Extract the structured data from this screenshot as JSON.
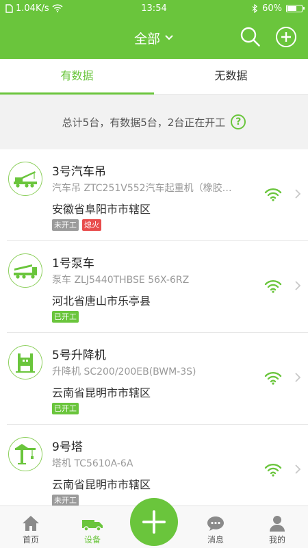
{
  "status_bar": {
    "speed": "1.04K/s",
    "time": "13:54",
    "battery": "60%",
    "battery_level": 0.6
  },
  "header": {
    "title": "全部"
  },
  "tabs": [
    {
      "label": "有数据"
    },
    {
      "label": "无数据"
    }
  ],
  "summary": {
    "text": "总计5台，有数据5台，2台正在开工",
    "help": "?"
  },
  "devices": [
    {
      "name": "3号汽车吊",
      "model": "汽车吊 ZTC251V552汽车起重机（橡胶…",
      "location": "安徽省阜阳市市辖区",
      "tags": [
        {
          "label": "未开工",
          "color": "#9b9b9b"
        },
        {
          "label": "熄火",
          "color": "#e84c4c"
        }
      ],
      "icon": "truck-crane-icon"
    },
    {
      "name": "1号泵车",
      "model": "泵车 ZLJ5440THBSE 56X-6RZ",
      "location": "河北省唐山市乐亭县",
      "tags": [
        {
          "label": "已开工",
          "color": "#6ac53c"
        }
      ],
      "icon": "pump-truck-icon"
    },
    {
      "name": "5号升降机",
      "model": "升降机 SC200/200EB(BWM-3S)",
      "location": "云南省昆明市市辖区",
      "tags": [
        {
          "label": "已开工",
          "color": "#6ac53c"
        }
      ],
      "icon": "elevator-icon"
    },
    {
      "name": "9号塔",
      "model": "塔机 TC5610A-6A",
      "location": "云南省昆明市市辖区",
      "tags": [
        {
          "label": "未开工",
          "color": "#9b9b9b"
        }
      ],
      "icon": "tower-crane-icon"
    }
  ],
  "bottom_nav": [
    {
      "label": "首页",
      "icon": "home-icon"
    },
    {
      "label": "设备",
      "icon": "device-icon"
    },
    {
      "label": "消息",
      "icon": "message-icon"
    },
    {
      "label": "我的",
      "icon": "profile-icon"
    }
  ],
  "colors": {
    "accent": "#6ac53c",
    "off": "#9b9b9b",
    "stop": "#e84c4c"
  }
}
